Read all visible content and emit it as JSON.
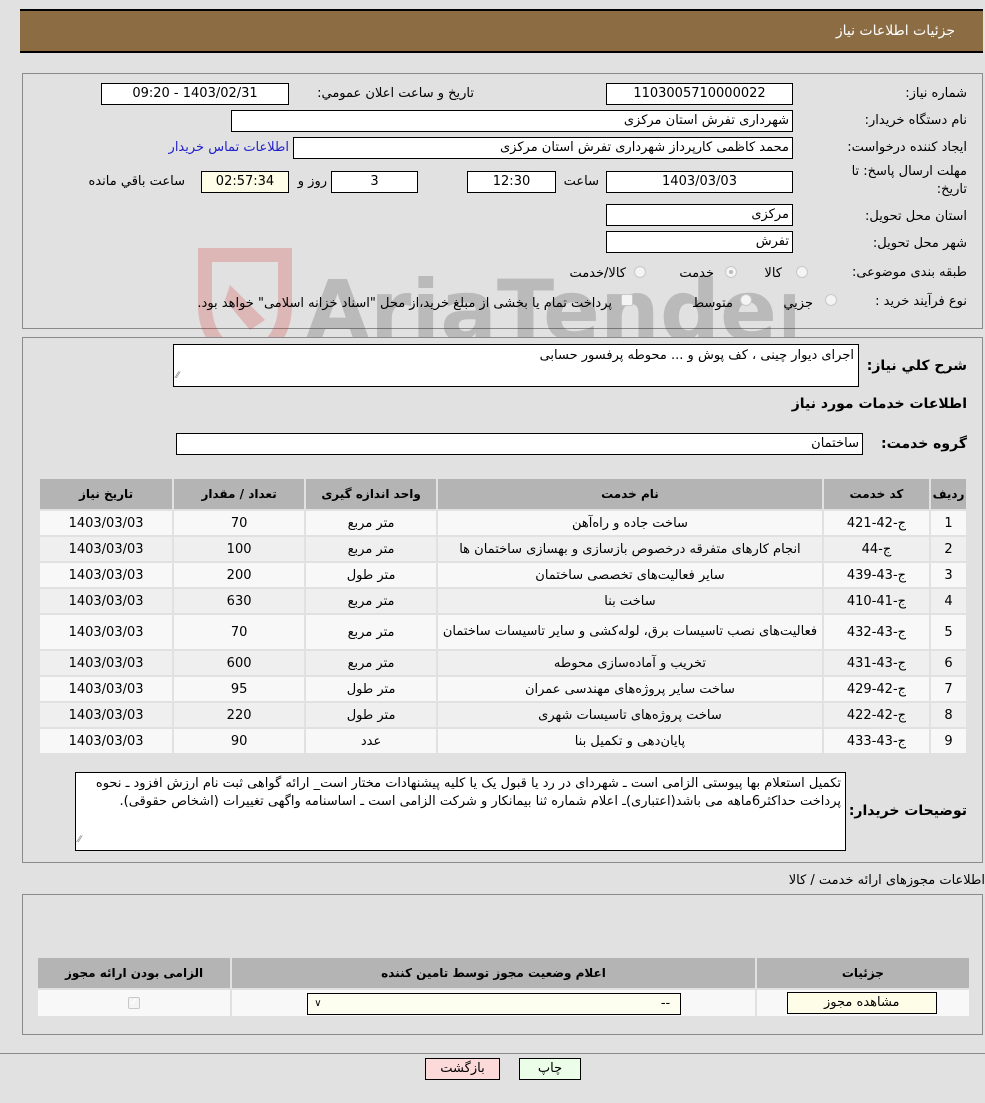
{
  "header": {
    "title": "جزئیات اطلاعات نیاز"
  },
  "form": {
    "need_number_label": "شماره نیاز:",
    "need_number": "1103005710000022",
    "announce_label": "تاریخ و ساعت اعلان عمومي:",
    "announce_value": "1403/02/31 - 09:20",
    "buyer_org_label": "نام دستگاه خریدار:",
    "buyer_org": "شهرداری تفرش استان مرکزی",
    "requester_label": "ایجاد کننده درخواست:",
    "requester": "محمد کاظمی کارپرداز شهرداری تفرش استان مرکزی",
    "contact_link": "اطلاعات تماس خریدار",
    "deadline_label_line1": "مهلت ارسال پاسخ: تا",
    "deadline_label_line2": "تاریخ:",
    "deadline_date": "1403/03/03",
    "time_label": "ساعت",
    "deadline_time": "12:30",
    "days_value": "3",
    "days_label": "روز و",
    "remaining_time": "02:57:34",
    "remaining_label": "ساعت باقي مانده",
    "province_label": "استان محل تحویل:",
    "province": "مرکزی",
    "city_label": "شهر محل تحویل:",
    "city": "تفرش",
    "category_label": "طبقه بندی موضوعی:",
    "category_options": [
      "کالا",
      "خدمت",
      "کالا/خدمت"
    ],
    "category_selected": "خدمت",
    "process_label": "نوع فرآیند خرید :",
    "process_options": [
      "جزيي",
      "متوسط"
    ],
    "treasury_note": "پرداخت تمام یا بخشی از مبلغ خرید،از محل \"اسناد خزانه اسلامی\" خواهد بود."
  },
  "description": {
    "label": "شرح کلي نیاز:",
    "value": "اجرای دیوار چینی ، کف پوش و ... محوطه پرفسور حسابی",
    "services_heading": "اطلاعات خدمات مورد نیاز",
    "service_group_label": "گروه خدمت:",
    "service_group": "ساختمان"
  },
  "services_table": {
    "headers": [
      "ردیف",
      "کد خدمت",
      "نام خدمت",
      "واحد اندازه گیری",
      "تعداد / مقدار",
      "تاریخ نیاز"
    ],
    "rows": [
      [
        "1",
        "ج-42-421",
        "ساخت جاده و راه‌آهن",
        "متر مربع",
        "70",
        "1403/03/03"
      ],
      [
        "2",
        "ج-44",
        "انجام کارهای متفرقه درخصوص بازسازی و بهسازی ساختمان ها",
        "متر مربع",
        "100",
        "1403/03/03"
      ],
      [
        "3",
        "ج-43-439",
        "سایر فعالیت‌های تخصصی ساختمان",
        "متر طول",
        "200",
        "1403/03/03"
      ],
      [
        "4",
        "ج-41-410",
        "ساخت بنا",
        "متر مربع",
        "630",
        "1403/03/03"
      ],
      [
        "5",
        "ج-43-432",
        "فعالیت‌های نصب تاسیسات برق، لوله‌کشی و سایر تاسیسات ساختمان",
        "متر مربع",
        "70",
        "1403/03/03"
      ],
      [
        "6",
        "ج-43-431",
        "تخریب و آماده‌سازی محوطه",
        "متر مربع",
        "600",
        "1403/03/03"
      ],
      [
        "7",
        "ج-42-429",
        "ساخت سایر پروژه‌های مهندسی عمران",
        "متر طول",
        "95",
        "1403/03/03"
      ],
      [
        "8",
        "ج-42-422",
        "ساخت پروژه‌های تاسیسات شهری",
        "متر طول",
        "220",
        "1403/03/03"
      ],
      [
        "9",
        "ج-43-433",
        "پایان‌دهی و تکمیل بنا",
        "عدد",
        "90",
        "1403/03/03"
      ]
    ]
  },
  "buyer_notes": {
    "label": "توضیحات خریدار:",
    "value": "تکمیل استعلام بها پیوستی الزامی است ـ شهردای در رد یا قبول یک یا کلیه پیشنهادات مختار است_ ارائه گواهی ثبت نام ارزش افزود ـ نحوه پرداخت حداکثر6ماهه می باشد(اعتباری)ـ اعلام شماره ثنا بیمانکار و شرکت الزامی است ـ اساسنامه واگهی تغییرات (اشخاص حقوقی)."
  },
  "permits": {
    "section_title": "اطلاعات مجوزهای ارائه خدمت / کالا",
    "headers": [
      "الزامی بودن ارائه مجوز",
      "اعلام وضعیت مجوز توسط تامین کننده",
      "جزئیات"
    ],
    "row": {
      "required_checked": true,
      "status_value": "--",
      "details_button": "مشاهده مجوز"
    }
  },
  "buttons": {
    "print": "چاپ",
    "back": "بازگشت"
  },
  "watermark": {
    "text": "AriaTender.neT"
  }
}
